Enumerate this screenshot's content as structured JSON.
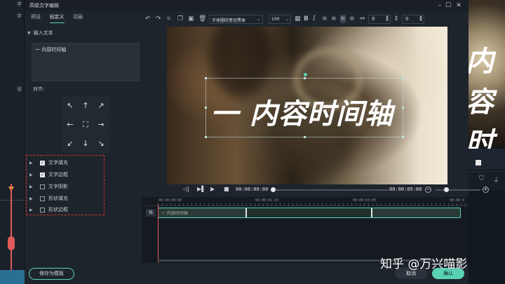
{
  "dialog": {
    "title": "高级文字编辑",
    "tabs": [
      "预设",
      "自定义",
      "动画"
    ],
    "active_tab": "自定义"
  },
  "left_panel": {
    "input_section_label": "输入文本",
    "input_text": "一 内容时间轴",
    "settings_section_label": "设",
    "align_label": "对齐:",
    "align_icons": [
      "arrow-up-left-icon",
      "arrow-up-icon",
      "arrow-up-right-icon",
      "arrow-left-icon",
      "center-icon",
      "arrow-right-icon",
      "arrow-down-left-icon",
      "arrow-down-icon",
      "arrow-down-right-icon"
    ],
    "align_glyphs": [
      "↖",
      "↑",
      "↗",
      "←",
      "⛶",
      "→",
      "↙",
      "↓",
      "↘"
    ],
    "properties": [
      {
        "label": "文字填充",
        "checked": true
      },
      {
        "label": "文字边框",
        "checked": true
      },
      {
        "label": "文字阴影",
        "checked": false
      },
      {
        "label": "形状填充",
        "checked": false
      },
      {
        "label": "形状边框",
        "checked": false
      }
    ],
    "save_template_label": "保存为模板"
  },
  "toolbar": {
    "font_name": "字体圈欣意冠黑体",
    "font_size": "100",
    "letter_spacing": "0",
    "line_spacing": "0",
    "icons": [
      "undo-icon",
      "redo-icon",
      "crop-icon",
      "copy-icon",
      "delete-icon",
      "bold-icon",
      "italic-icon",
      "align-left-icon",
      "align-center-icon",
      "align-right-icon",
      "letter-spacing-icon",
      "line-spacing-icon"
    ]
  },
  "preview": {
    "overlay_text": "一 内容时间轴"
  },
  "transport": {
    "current_time": "00:00:00:00",
    "total_time": "00:00:05:00"
  },
  "timeline": {
    "ruler_labels": [
      "00:00:00:00",
      "00:00:01:15",
      "00:00:03:05",
      "00:00:0"
    ],
    "clip_label": "一 内容时间轴"
  },
  "buttons": {
    "cancel": "取消",
    "ok": "确认"
  },
  "background_app": {
    "right_text": "内容时",
    "left_labels": [
      "字",
      "字",
      "设"
    ]
  },
  "watermark": "知乎 @万兴喵影",
  "colors": {
    "accent": "#5ad2b4",
    "highlight_dash": "#d0352f",
    "playhead": "#e05c5c"
  }
}
